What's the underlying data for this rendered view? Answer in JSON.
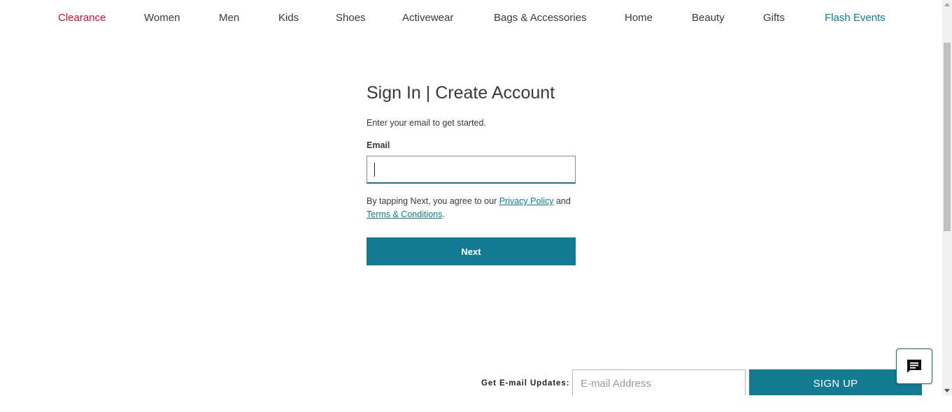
{
  "nav": {
    "items": [
      {
        "label": "Clearance",
        "color": "#c8102e"
      },
      {
        "label": "Women",
        "color": "#393939"
      },
      {
        "label": "Men",
        "color": "#393939"
      },
      {
        "label": "Kids",
        "color": "#393939"
      },
      {
        "label": "Shoes",
        "color": "#393939"
      },
      {
        "label": "Activewear",
        "color": "#393939"
      },
      {
        "label": "Bags & Accessories",
        "color": "#393939"
      },
      {
        "label": "Home",
        "color": "#393939"
      },
      {
        "label": "Beauty",
        "color": "#393939"
      },
      {
        "label": "Gifts",
        "color": "#393939"
      },
      {
        "label": "Flash Events",
        "color": "#0e7c95"
      }
    ]
  },
  "signin": {
    "title": "Sign In | Create Account",
    "subtitle": "Enter your email to get started.",
    "email_label": "Email",
    "email_value": "",
    "legal_prefix": "By tapping Next, you agree to our ",
    "privacy_link": "Privacy Policy",
    "legal_and": " and ",
    "terms_link": "Terms & Conditions",
    "legal_suffix": ".",
    "next_label": "Next"
  },
  "newsletter": {
    "label": "Get E-mail Updates:",
    "placeholder": "E-mail Address",
    "button_label": "SIGN UP"
  },
  "chat": {
    "icon": "chat-bubble-icon"
  },
  "colors": {
    "accent": "#127b92",
    "link": "#0e7c95",
    "clearance": "#c8102e"
  }
}
